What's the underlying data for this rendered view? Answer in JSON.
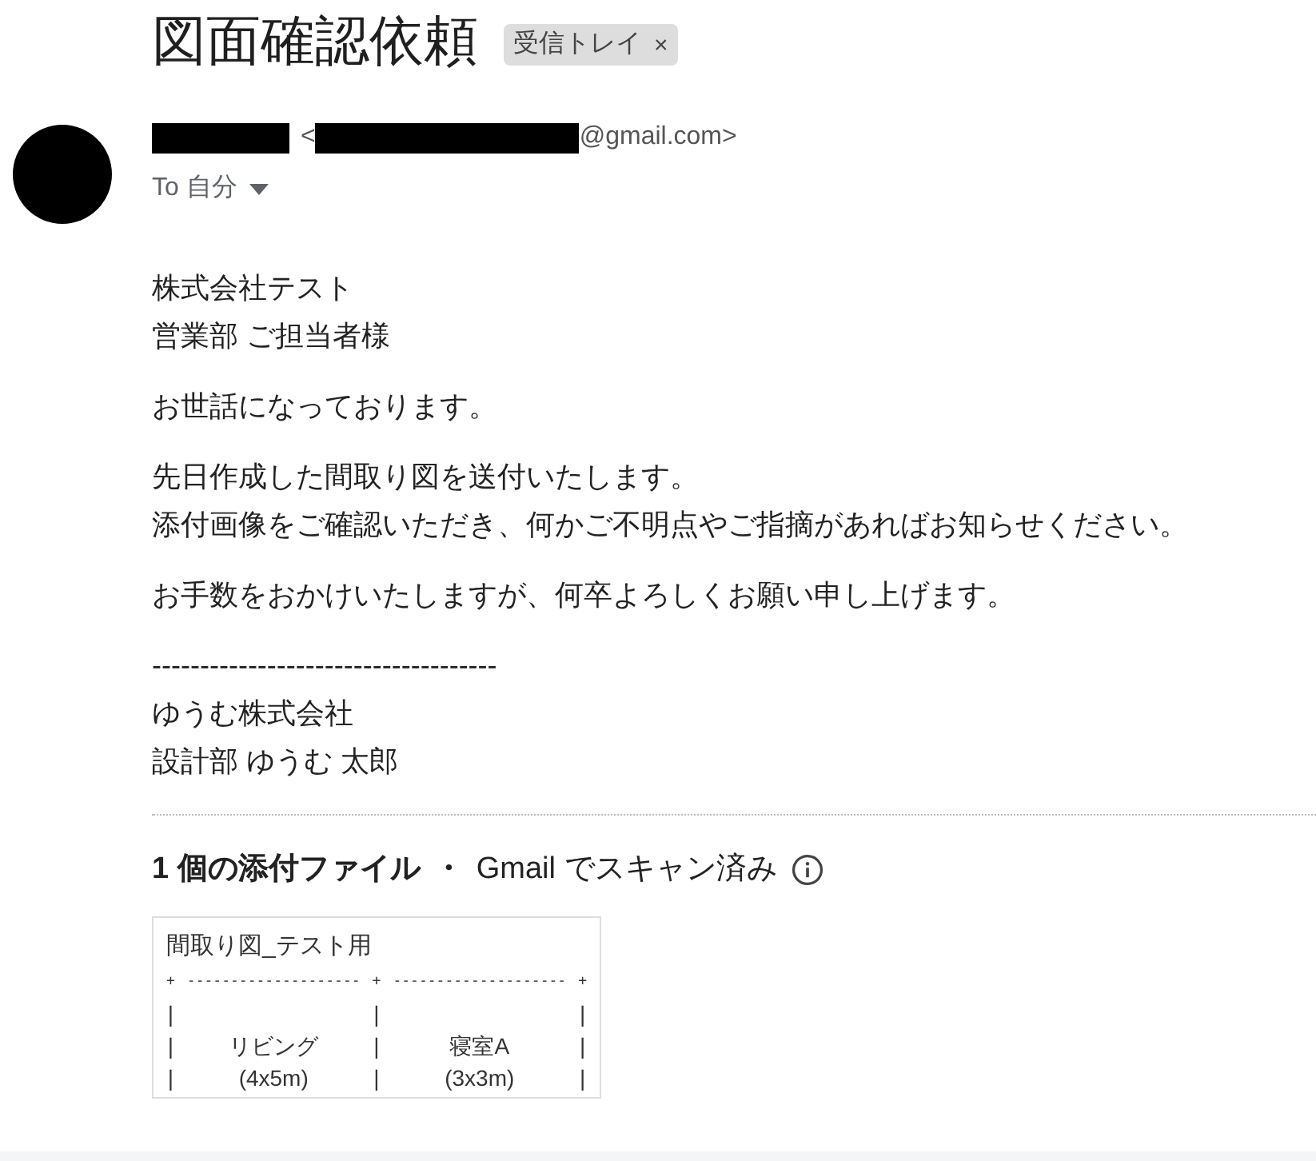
{
  "subject": "図面確認依頼",
  "label_chip": {
    "text": "受信トレイ",
    "close": "×"
  },
  "sender": {
    "open": "<",
    "domain": "@gmail.com>"
  },
  "recipient": {
    "text": "To 自分"
  },
  "body": [
    [
      "株式会社テスト",
      "営業部 ご担当者様"
    ],
    [
      "お世話になっております。"
    ],
    [
      "先日作成した間取り図を送付いたします。",
      "添付画像をご確認いただき、何かご不明点やご指摘があればお知らせください。"
    ],
    [
      "お手数をおかけいたしますが、何卒よろしくお願い申し上げます。"
    ],
    [
      "------------------------------------",
      "ゆうむ株式会社",
      "設計部 ゆうむ 太郎"
    ]
  ],
  "attachments": {
    "count": "1 個の添付ファイル",
    "separator": "・",
    "scan": "Gmail でスキャン済み"
  },
  "preview": {
    "title": "間取り図_テスト用",
    "border": [
      "+",
      "--------------------",
      "+",
      "--------------------",
      "+"
    ],
    "rows": [
      [
        "|",
        "",
        "|",
        "",
        "|"
      ],
      [
        "|",
        "リビング",
        "|",
        "寝室A",
        "|"
      ],
      [
        "|",
        "(4x5m)",
        "|",
        "(3x3m)",
        "|"
      ]
    ]
  }
}
